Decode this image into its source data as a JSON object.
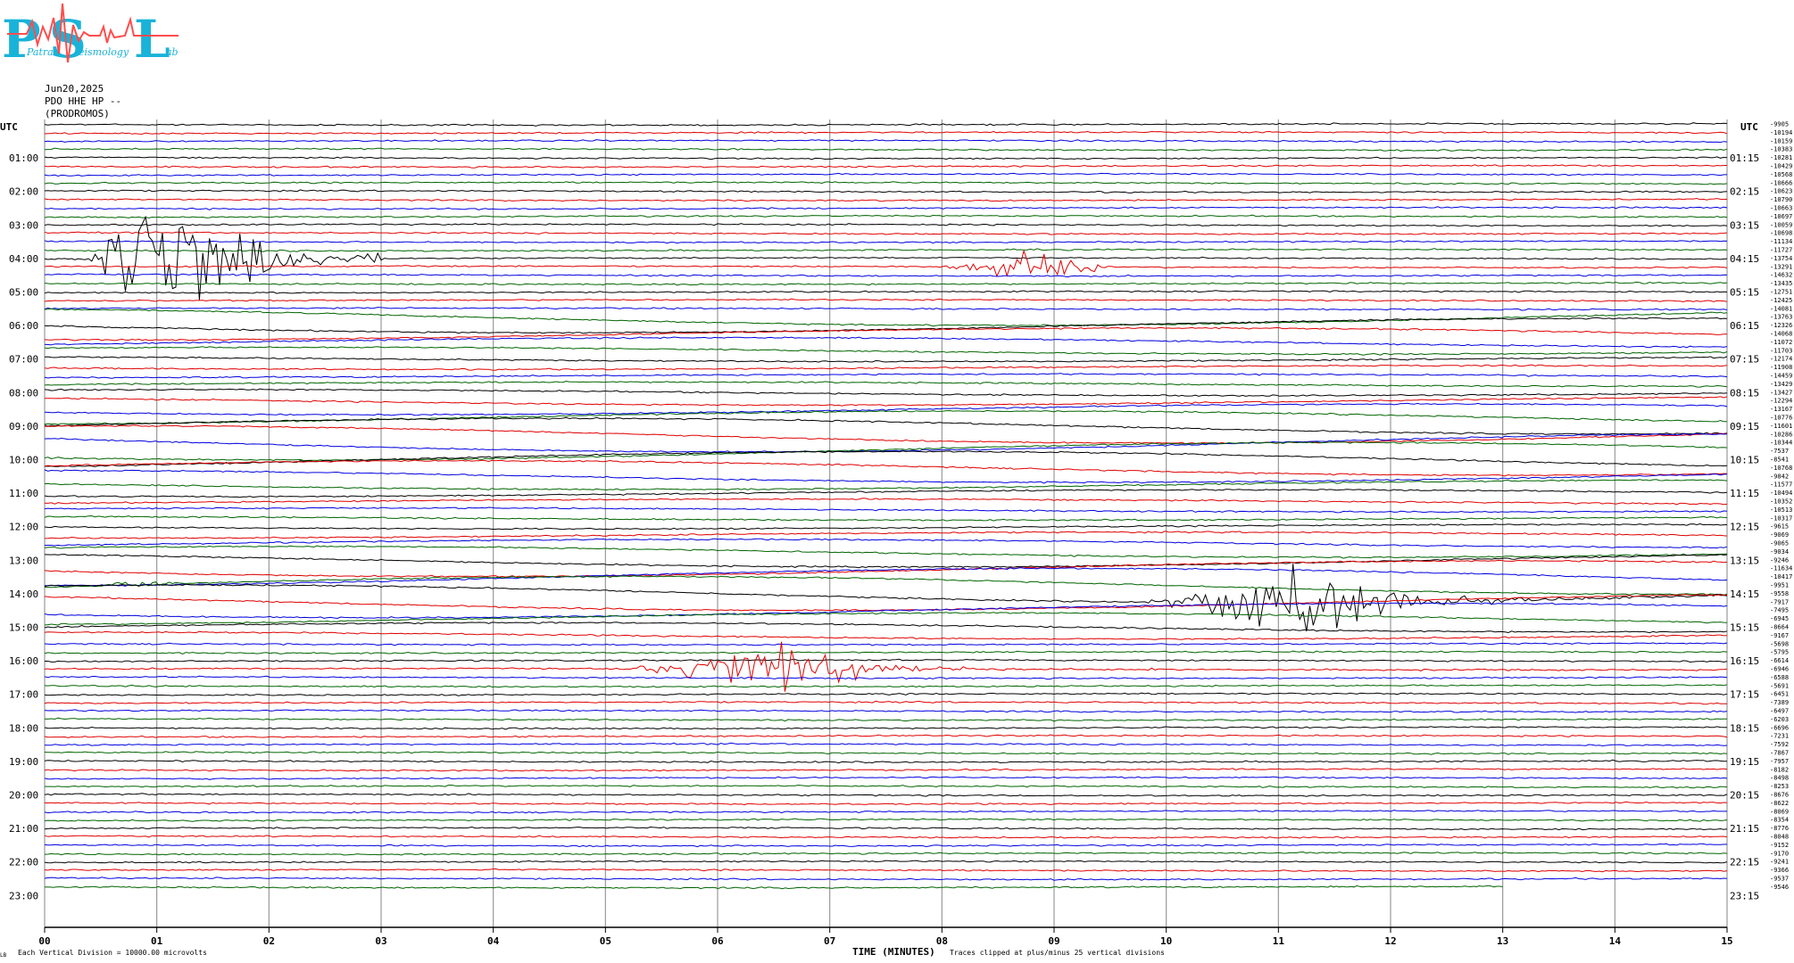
{
  "logo": {
    "letters": [
      "P",
      "S",
      "L"
    ],
    "words": [
      "Patras",
      "eismology",
      "ab"
    ],
    "color": "#1ab3d8",
    "accent": "#ff4d4d"
  },
  "header": {
    "date": "Jun20,2025",
    "station": "PDO HHE HP --",
    "location": "(PRODROMOS)"
  },
  "footer": {
    "left_mark": "LB",
    "scale_note": "Each Vertical Division = 10000.00 microvolts",
    "clip_note": "Traces clipped at plus/minus 25 vertical divisions"
  },
  "chart_data": {
    "type": "line",
    "xlabel": "TIME (MINUTES)",
    "x_ticks": [
      "00",
      "01",
      "02",
      "03",
      "04",
      "05",
      "06",
      "07",
      "08",
      "09",
      "10",
      "11",
      "12",
      "13",
      "14",
      "15"
    ],
    "xlim": [
      0,
      15
    ],
    "utc_label": "UTC",
    "left_hour_labels": [
      "01:00",
      "02:00",
      "03:00",
      "04:00",
      "05:00",
      "06:00",
      "07:00",
      "08:00",
      "09:00",
      "10:00",
      "11:00",
      "12:00",
      "13:00",
      "14:00",
      "15:00",
      "16:00",
      "17:00",
      "18:00",
      "19:00",
      "20:00",
      "21:00",
      "22:00",
      "23:00"
    ],
    "right_hour_labels": [
      "01:15",
      "02:15",
      "03:15",
      "04:15",
      "05:15",
      "06:15",
      "07:15",
      "08:15",
      "09:15",
      "10:15",
      "11:15",
      "12:15",
      "13:15",
      "14:15",
      "15:15",
      "16:15",
      "17:15",
      "18:15",
      "19:15",
      "20:15",
      "21:15",
      "22:15",
      "23:15"
    ],
    "trace_colors": [
      "#000000",
      "#e00000",
      "#0000e0",
      "#006400"
    ],
    "grid": true,
    "num_traces": 92,
    "last_trace_end_minute": 13,
    "trace_offsets": [
      "-9905",
      "-10194",
      "-10159",
      "-10383",
      "-10281",
      "-10429",
      "-10568",
      "-10666",
      "-10623",
      "-10790",
      "-10663",
      "-10697",
      "-10059",
      "-10698",
      "-11134",
      "-11727",
      "-13754",
      "-13291",
      "-14632",
      "-13435",
      "-12751",
      "-12425",
      "-14081",
      "-13763",
      "-12326",
      "-14068",
      "-11072",
      "-11703",
      "-12174",
      "-11908",
      "-14459",
      "-13429",
      "-13427",
      "-12294",
      "-13167",
      "-10776",
      "-11601",
      "-10286",
      "-10344",
      "-7537",
      "-8541",
      "-10768",
      "-9842",
      "-11577",
      "-10494",
      "-10352",
      "-10513",
      "-10317",
      "-9615",
      "-9069",
      "-9065",
      "-9034",
      "-9246",
      "-11634",
      "-10417",
      "-9951",
      "-9558",
      "-7917",
      "-7495",
      "-6945",
      "-8664",
      "-9167",
      "-5698",
      "-5795",
      "-6614",
      "-6946",
      "-6588",
      "-5691",
      "-6451",
      "-7389",
      "-6497",
      "-6203",
      "-6696",
      "-7231",
      "-7592",
      "-7867",
      "-7957",
      "-8182",
      "-8498",
      "-8253",
      "-8676",
      "-8622",
      "-8069",
      "-8354",
      "-8776",
      "-8048",
      "-9152",
      "-9170",
      "-9241",
      "-9366",
      "-9537",
      "-9546"
    ],
    "events": [
      {
        "trace": 16,
        "start_min": 0.4,
        "end_min": 3.0,
        "peak_min": 0.9,
        "amplitude_divisions": 2.3
      },
      {
        "trace": 17,
        "start_min": 8.0,
        "end_min": 9.4,
        "peak_min": 8.8,
        "amplitude_divisions": 0.4
      },
      {
        "trace": 55,
        "start_min": 0.4,
        "end_min": 1.2,
        "peak_min": 0.7,
        "amplitude_divisions": 0.1
      },
      {
        "trace": 56,
        "start_min": 9.8,
        "end_min": 15.0,
        "peak_min": 11.4,
        "amplitude_divisions": 0.9
      },
      {
        "trace": 65,
        "start_min": 5.1,
        "end_min": 15.0,
        "peak_min": 6.7,
        "amplitude_divisions": 0.6
      }
    ]
  }
}
